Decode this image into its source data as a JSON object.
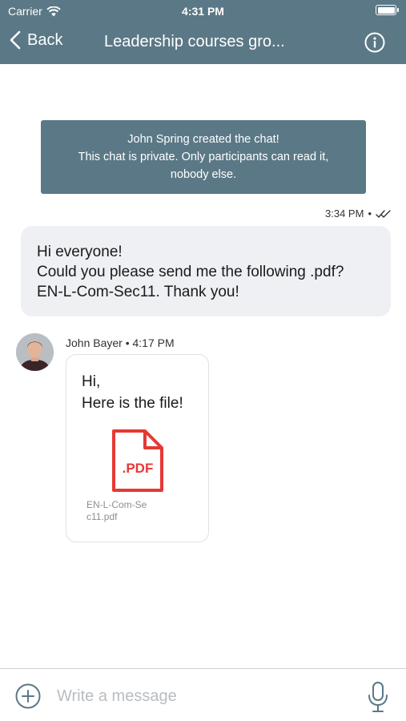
{
  "status_bar": {
    "carrier": "Carrier",
    "time": "4:31 PM"
  },
  "nav": {
    "back_label": "Back",
    "title": "Leadership courses gro..."
  },
  "system_message": {
    "lines": [
      "John Spring created the chat!",
      "This chat is private. Only participants can read it,",
      "nobody else."
    ]
  },
  "sent_message": {
    "time": "3:34 PM",
    "separator": "•",
    "lines": [
      "Hi everyone!",
      "Could you please send me the following .pdf?",
      "EN-L-Com-Sec11. Thank you!"
    ]
  },
  "received_message": {
    "sender": "John Bayer",
    "time": "4:17 PM",
    "meta": "John Bayer • 4:17 PM",
    "lines": [
      "Hi,",
      "Here is the file!"
    ],
    "attachment": {
      "type_label": ".PDF",
      "file_name": "EN-L-Com-Sec11.pdf"
    }
  },
  "composer": {
    "placeholder": "Write a message"
  },
  "colors": {
    "header": "#5b7886",
    "bubble_sent": "#eef0f3",
    "pdf": "#e53935"
  }
}
